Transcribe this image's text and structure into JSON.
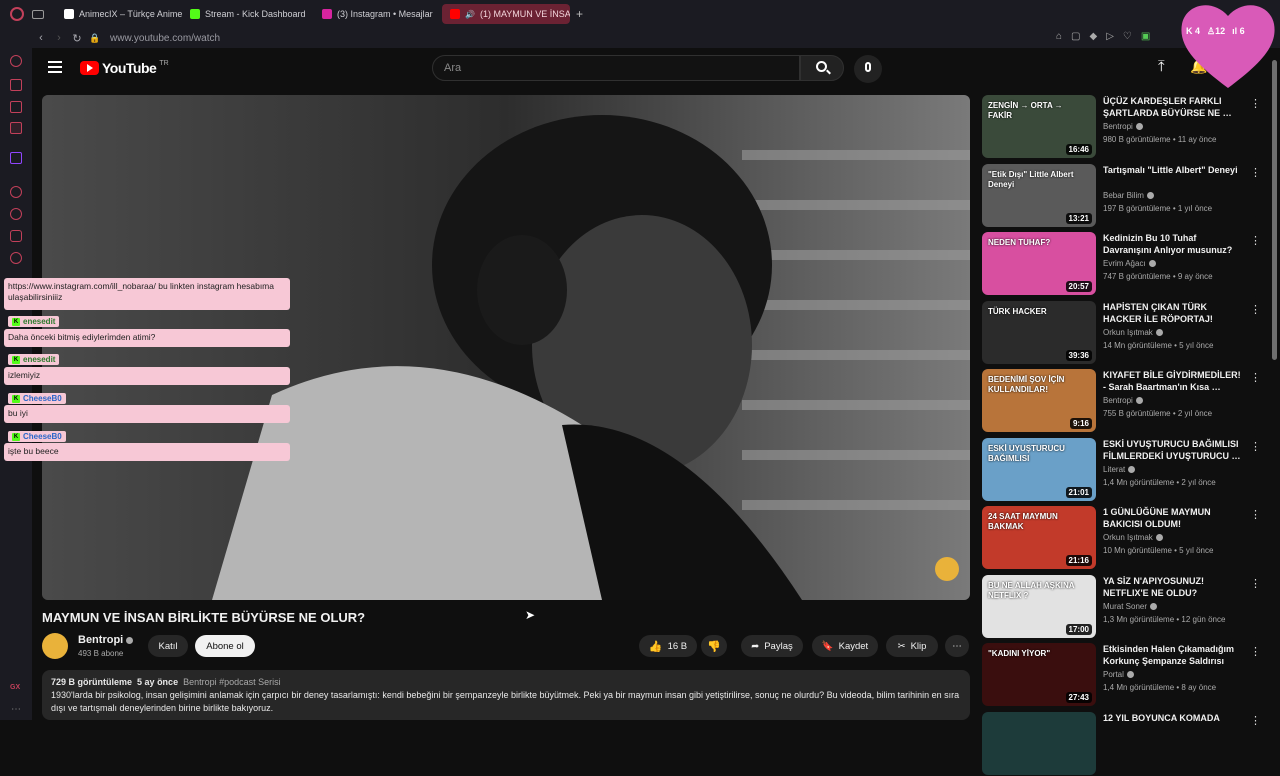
{
  "browser": {
    "tabs": [
      {
        "label": "AnimecIX – Türkçe Anime …",
        "color": "#ffffff",
        "active": false
      },
      {
        "label": "Stream - Kick Dashboard",
        "color": "#53fc18",
        "active": false
      },
      {
        "label": "(3) Instagram • Mesajlar",
        "color": "#d6249f",
        "active": false
      },
      {
        "label": "(1) MAYMUN VE İNSAN",
        "color": "#ff0000",
        "active": true
      }
    ],
    "url": "www.youtube.com/watch"
  },
  "youtube": {
    "logo": "YouTube",
    "region": "TR",
    "search_placeholder": "Ara"
  },
  "overlay": {
    "stats": {
      "kick": "4",
      "followers": "12",
      "viewers": "6"
    },
    "chat": [
      {
        "user": "",
        "text": "https://www.instagram.com/ill_nobaraa/ bu linkten instagram hesabıma ulaşabilirsiniiiz"
      },
      {
        "user": "enesedit",
        "text": "Daha önceki bitmiş ediyleri̇mden atimi?"
      },
      {
        "user": "enesedit",
        "text": "izlemiyiz"
      },
      {
        "user": "CheeseB0",
        "text": "bu iyi"
      },
      {
        "user": "CheeseB0",
        "text": "işte bu beece"
      }
    ]
  },
  "video": {
    "title": "MAYMUN VE İNSAN BİRLİKTE BÜYÜRSE NE OLUR?",
    "channel": "Bentropi",
    "subscribers": "493 B abone",
    "join_label": "Katıl",
    "subscribe_label": "Abone ol",
    "likes": "16 B",
    "share_label": "Paylaş",
    "save_label": "Kaydet",
    "clip_label": "Klip",
    "views": "729 B görüntüleme",
    "date": "5 ay önce",
    "tags": "Bentropi  #podcast Serisi",
    "description": "1930'larda bir psikolog, insan gelişimini anlamak için çarpıcı bir deney tasarlamıştı: kendi bebeğini bir şempanzeyle birlikte büyütmek. Peki ya bir maymun insan gibi yetiştirilirse, sonuç ne olurdu? Bu videoda, bilim tarihinin en sıra dışı ve tartışmalı deneylerinden birine birlikte bakıyoruz."
  },
  "recommendations": [
    {
      "title": "ÜÇÜZ KARDEŞLER FARKLI ŞARTLARDA BÜYÜRSE NE …",
      "channel": "Bentropi",
      "meta": "980 B görüntüleme • 11 ay önce",
      "duration": "16:46",
      "thumb": "#3a4a3a",
      "thumb_text": "ZENGİN → ORTA → FAKİR"
    },
    {
      "title": "Tartışmalı \"Little Albert\" Deneyi",
      "channel": "Bebar Bilim",
      "meta": "197 B görüntüleme • 1 yıl önce",
      "duration": "13:21",
      "thumb": "#5a5a5a",
      "thumb_text": "\"Etik Dışı\" Little Albert Deneyi"
    },
    {
      "title": "Kedinizin Bu 10 Tuhaf Davranışını Anlıyor musunuz?",
      "channel": "Evrim Ağacı",
      "meta": "747 B görüntüleme • 9 ay önce",
      "duration": "20:57",
      "thumb": "#d84fa0",
      "thumb_text": "NEDEN TUHAF?"
    },
    {
      "title": "HAPİSTEN ÇIKAN TÜRK HACKER İLE RÖPORTAJ!",
      "channel": "Orkun Işıtmak",
      "meta": "14 Mn görüntüleme • 5 yıl önce",
      "duration": "39:36",
      "thumb": "#2b2b2b",
      "thumb_text": "TÜRK HACKER"
    },
    {
      "title": "KIYAFET BİLE GİYDİRMEDİLER! - Sarah Baartman'ın Kısa …",
      "channel": "Bentropi",
      "meta": "755 B görüntüleme • 2 yıl önce",
      "duration": "9:16",
      "thumb": "#b8743a",
      "thumb_text": "BEDENİMİ ŞOV İÇİN KULLANDILAR!"
    },
    {
      "title": "ESKİ UYUŞTURUCU BAĞIMLISI FİLMLERDEKİ UYUŞTURUCU …",
      "channel": "Literat",
      "meta": "1,4 Mn görüntüleme • 2 yıl önce",
      "duration": "21:01",
      "thumb": "#6aa0c8",
      "thumb_text": "ESKİ UYUŞTURUCU BAĞIMLISI"
    },
    {
      "title": "1 GÜNLÜĞÜNE MAYMUN BAKICISI OLDUM!",
      "channel": "Orkun Işıtmak",
      "meta": "10 Mn görüntüleme • 5 yıl önce",
      "duration": "21:16",
      "thumb": "#c23a2a",
      "thumb_text": "24 SAAT MAYMUN BAKMAK"
    },
    {
      "title": "YA SİZ N'APIYOSUNUZ! NETFLIX'E NE OLDU?",
      "channel": "Murat Soner",
      "meta": "1,3 Mn görüntüleme • 12 gün önce",
      "duration": "17:00",
      "thumb": "#e2e2e2",
      "thumb_text": "BU NE ALLAH AŞKINA NETFLIX ?"
    },
    {
      "title": "Etkisinden Halen Çıkamadığım Korkunç Şempanze Saldırısı",
      "channel": "Portal",
      "meta": "1,4 Mn görüntüleme • 8 ay önce",
      "duration": "27:43",
      "thumb": "#3a0e0e",
      "thumb_text": "\"KADINI YİYOR\""
    },
    {
      "title": "12 YIL BOYUNCA KOMADA",
      "channel": "",
      "meta": "",
      "duration": "",
      "thumb": "#1d3b3a",
      "thumb_text": ""
    }
  ]
}
